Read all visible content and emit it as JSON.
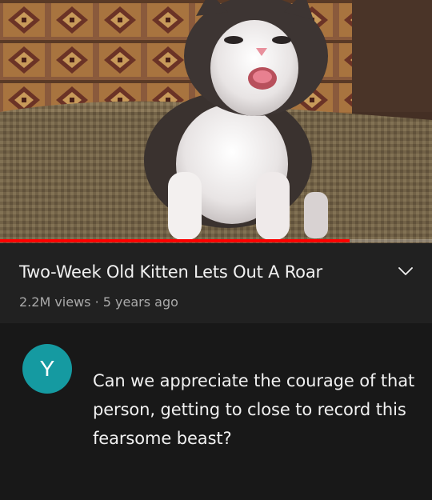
{
  "video": {
    "thumbnail_description_icon": "kitten-thumbnail",
    "progress_fraction": 0.81,
    "progress_color": "#ff0000"
  },
  "info": {
    "title": "Two-Week Old Kitten Lets Out A Roar",
    "meta": "2.2M views · 5 years ago",
    "expand_icon": "chevron-down-icon"
  },
  "comment": {
    "avatar_letter": "Y",
    "avatar_color": "#159aa1",
    "text": "Can we appreciate the courage of that person, getting to close to record this fearsome beast?"
  }
}
